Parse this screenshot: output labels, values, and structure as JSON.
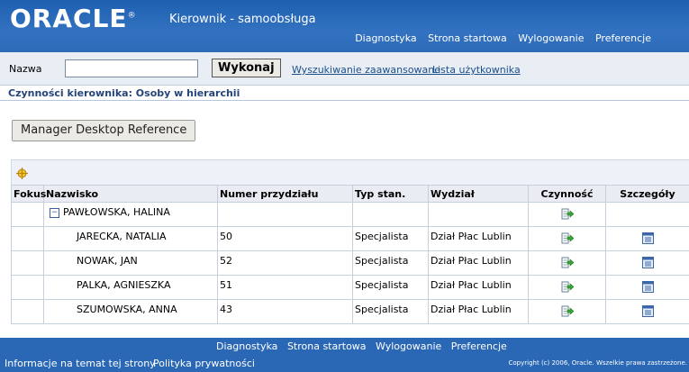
{
  "header": {
    "logo": "ORACLE",
    "app_title": "Kierownik - samoobsługa",
    "nav": [
      "Diagnostyka",
      "Strona startowa",
      "Wylogowanie",
      "Preferencje"
    ]
  },
  "search": {
    "label": "Nazwa",
    "value": "",
    "go_label": "Wykonaj",
    "advanced_link": "Wyszukiwanie zaawansowane",
    "users_link": "Lista użytkownika"
  },
  "page": {
    "title": "Czynności kierownika: Osoby w hierarchii",
    "ref_button": "Manager Desktop Reference"
  },
  "table": {
    "columns": [
      "Fokus",
      "Nazwisko",
      "Numer przydziału",
      "Typ stan.",
      "Wydział",
      "Czynność",
      "Szczegóły"
    ],
    "rows": [
      {
        "name": "PAWŁOWSKA, HALINA",
        "num": "",
        "type": "",
        "dept": "",
        "expanded": true
      },
      {
        "name": "JARECKA, NATALIA",
        "num": "50",
        "type": "Specjalista",
        "dept": "Dział Płac Lublin"
      },
      {
        "name": "NOWAK, JAN",
        "num": "52",
        "type": "Specjalista",
        "dept": "Dział Płac Lublin"
      },
      {
        "name": "PALKA, AGNIESZKA",
        "num": "51",
        "type": "Specjalista",
        "dept": "Dział Płac Lublin"
      },
      {
        "name": "SZUMOWSKA, ANNA",
        "num": "43",
        "type": "Specjalista",
        "dept": "Dział Płac Lublin"
      }
    ]
  },
  "footer": {
    "nav": [
      "Diagnostyka",
      "Strona startowa",
      "Wylogowanie",
      "Preferencje"
    ],
    "about": "Informacje na temat tej strony",
    "privacy": "Polityka prywatności",
    "copyright": "Copyright (c) 2006, Oracle. Wszelkie prawa zastrzeżone."
  },
  "colors": {
    "brand_blue": "#2e6bb8",
    "link": "#1c4f8a"
  }
}
